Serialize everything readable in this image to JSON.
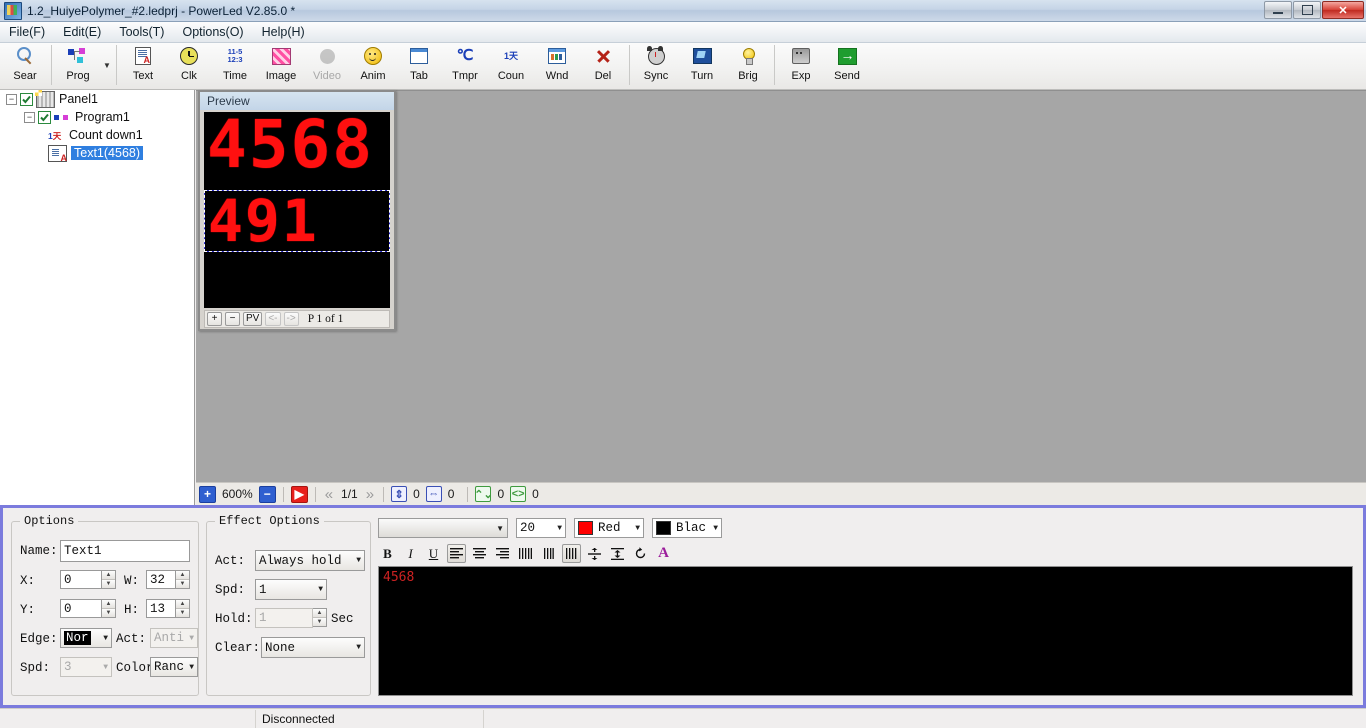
{
  "window": {
    "title": "1.2_HuiyePolymer_#2.ledprj - PowerLed V2.85.0 *",
    "minimize_label": "",
    "restore_label": "",
    "close_label": "✕"
  },
  "menubar": {
    "items": [
      {
        "label": "File(F)"
      },
      {
        "label": "Edit(E)"
      },
      {
        "label": "Tools(T)"
      },
      {
        "label": "Options(O)"
      },
      {
        "label": "Help(H)"
      }
    ]
  },
  "toolbar": {
    "buttons": [
      {
        "label": "Sear",
        "icon": "search-icon",
        "enabled": true
      },
      {
        "label": "Prog",
        "icon": "program-icon",
        "enabled": true
      },
      {
        "label": "Text",
        "icon": "text-document-icon",
        "enabled": true
      },
      {
        "label": "Clk",
        "icon": "clock-icon",
        "enabled": true
      },
      {
        "label": "Time",
        "icon": "time-digits-icon",
        "enabled": true
      },
      {
        "label": "Image",
        "icon": "image-icon",
        "enabled": true
      },
      {
        "label": "Video",
        "icon": "video-icon",
        "enabled": false
      },
      {
        "label": "Anim",
        "icon": "animation-smiley-icon",
        "enabled": true
      },
      {
        "label": "Tab",
        "icon": "table-icon",
        "enabled": true
      },
      {
        "label": "Tmpr",
        "icon": "temperature-icon",
        "enabled": true
      },
      {
        "label": "Coun",
        "icon": "counter-icon",
        "enabled": true
      },
      {
        "label": "Wnd",
        "icon": "window-icon",
        "enabled": true
      },
      {
        "label": "Del",
        "icon": "delete-x-icon",
        "enabled": true
      },
      {
        "label": "Sync",
        "icon": "sync-clock-icon",
        "enabled": true
      },
      {
        "label": "Turn",
        "icon": "turn-screen-icon",
        "enabled": true
      },
      {
        "label": "Brig",
        "icon": "brightness-bulb-icon",
        "enabled": true
      },
      {
        "label": "Exp",
        "icon": "export-icon",
        "enabled": true
      },
      {
        "label": "Send",
        "icon": "send-arrow-icon",
        "enabled": true
      }
    ],
    "time_icon_lines": [
      "11-5",
      "12:3"
    ],
    "counter_icon_text": "1天",
    "tmpr_icon_text": "℃"
  },
  "tree": {
    "nodes": [
      {
        "label": "Panel1",
        "checked": true,
        "expanded": true,
        "selected": false,
        "icon": "panel-icon"
      },
      {
        "label": "Program1",
        "checked": true,
        "expanded": true,
        "selected": false,
        "icon": "program-icon"
      },
      {
        "label": "Count down1",
        "checked": false,
        "expanded": false,
        "selected": false,
        "icon": "countdown-icon"
      },
      {
        "label": "Text1(4568)",
        "checked": false,
        "expanded": false,
        "selected": true,
        "icon": "text-icon"
      }
    ]
  },
  "preview": {
    "title": "Preview",
    "rows": [
      {
        "text": "4568",
        "selected": false
      },
      {
        "text": "491",
        "selected": true
      }
    ],
    "controls": {
      "zoom_in": "+",
      "zoom_out": "−",
      "pv": "PV",
      "prev": "<-",
      "next": "->",
      "page_text": "P 1 of 1"
    }
  },
  "canvas_status": {
    "zoom_in": "+",
    "zoom_level": "600%",
    "zoom_out": "−",
    "play": "▶",
    "first": "«",
    "page": "1/1",
    "last": "»",
    "v_scroll_value": "0",
    "h_scroll_value": "0",
    "v_size_value": "0",
    "h_size_value": "0"
  },
  "options_panel": {
    "legend": "Options",
    "name_label": "Name:",
    "name_value": "Text1",
    "x_label": "X:",
    "x_value": "0",
    "w_label": "W:",
    "w_value": "32",
    "y_label": "Y:",
    "y_value": "0",
    "h_label": "H:",
    "h_value": "13",
    "edge_label": "Edge:",
    "edge_value": "Nor",
    "act_label": "Act:",
    "act_value": "Anti",
    "spd_label": "Spd:",
    "spd_value": "3",
    "color_label": "Color:",
    "color_value": "Ranc"
  },
  "effect_panel": {
    "legend": "Effect Options",
    "act_label": "Act:",
    "act_value": "Always hold",
    "spd_label": "Spd:",
    "spd_value": "1",
    "hold_label": "Hold:",
    "hold_value": "1",
    "hold_unit": "Sec",
    "clear_label": "Clear:",
    "clear_value": "None"
  },
  "font_toolbar": {
    "font_family_value": "",
    "font_size_value": "20",
    "fore_color_label": "Red",
    "fore_color_hex": "#ff0000",
    "back_color_label": "Blac",
    "back_color_hex": "#000000",
    "buttons": [
      {
        "name": "bold",
        "glyph": "B",
        "active": false
      },
      {
        "name": "italic",
        "glyph": "I",
        "active": false
      },
      {
        "name": "underline",
        "glyph": "U",
        "active": false
      },
      {
        "name": "align-left",
        "glyph": "▤",
        "active": true
      },
      {
        "name": "align-center",
        "glyph": "▤",
        "active": false
      },
      {
        "name": "align-right",
        "glyph": "▤",
        "active": false
      },
      {
        "name": "spacing-wide",
        "glyph": "|||||",
        "active": false
      },
      {
        "name": "spacing-narrow",
        "glyph": "|||",
        "active": false
      },
      {
        "name": "spacing-normal",
        "glyph": "||||",
        "active": true
      },
      {
        "name": "align-vertical-center",
        "glyph": "≑",
        "active": false
      },
      {
        "name": "line-spacing",
        "glyph": "⇞",
        "active": false
      },
      {
        "name": "reset-rotate",
        "glyph": "↺",
        "active": false
      },
      {
        "name": "font-color",
        "glyph": "A",
        "active": false
      }
    ]
  },
  "editor": {
    "text": "4568",
    "text_color": "#cc2222",
    "background": "#000000"
  },
  "statusbar": {
    "cell1": "",
    "cell2": "Disconnected",
    "cell3": ""
  },
  "colors": {
    "accent_border": "#7b7bdd",
    "led_red": "#ff1010",
    "selection_blue": "#2f7fe0",
    "canvas_gray": "#a6a6a6"
  }
}
